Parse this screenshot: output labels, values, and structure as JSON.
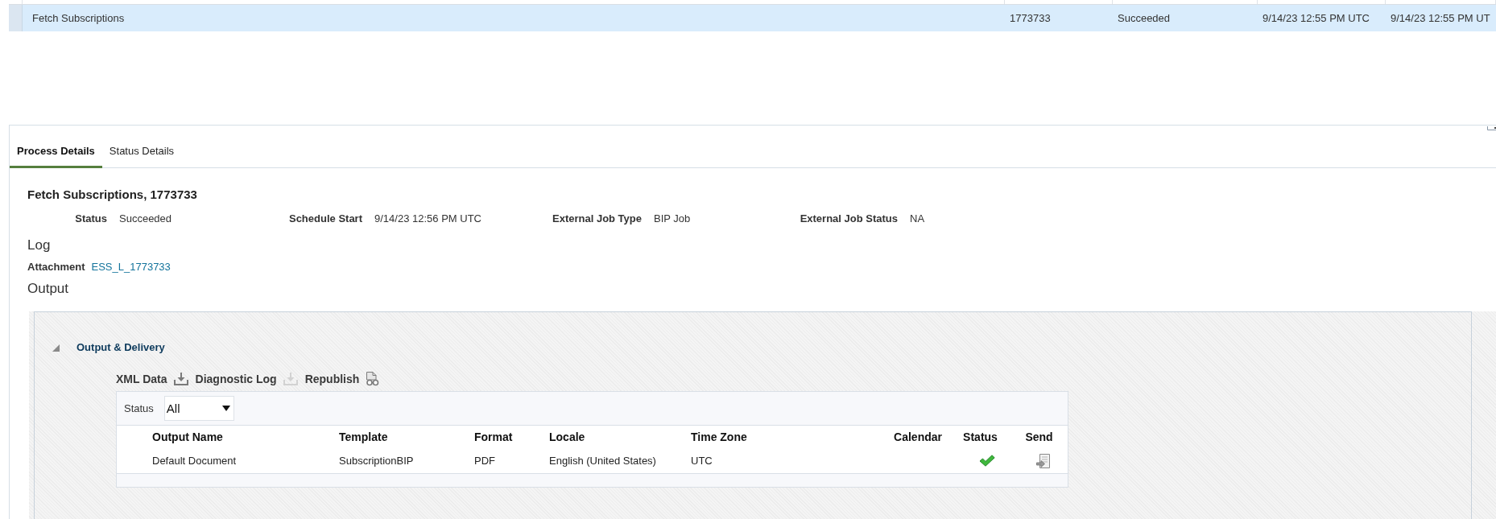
{
  "job_list": {
    "rows": [
      {
        "cells": [
          "Fetch Subscriptions",
          "1773733",
          "Succeeded",
          "9/14/23 12:55 PM UTC",
          "9/14/23 12:55 PM UT"
        ],
        "selected": true
      }
    ]
  },
  "tabs": [
    {
      "label": "Process Details",
      "selected": true
    },
    {
      "label": "Status Details",
      "selected": false
    }
  ],
  "process": {
    "title": "Fetch Subscriptions, 1773733",
    "fields": [
      {
        "label": "Status",
        "value": "Succeeded"
      },
      {
        "label": "Schedule Start",
        "value": "9/14/23 12:56 PM UTC"
      },
      {
        "label": "External Job Type",
        "value": "BIP Job"
      },
      {
        "label": "External Job Status",
        "value": "NA"
      }
    ]
  },
  "log": {
    "heading": "Log",
    "attachment_label": "Attachment",
    "attachment_link": "ESS_L_1773733"
  },
  "output": {
    "heading": "Output",
    "section": {
      "title": "Output & Delivery",
      "expanded": true,
      "toolbar": [
        {
          "label": "XML Data",
          "kind": "download",
          "disabled": false
        },
        {
          "label": "Diagnostic Log",
          "kind": "download",
          "disabled": true
        },
        {
          "label": "Republish",
          "kind": "republish",
          "disabled": false
        }
      ],
      "filter": {
        "label": "Status",
        "value": "All"
      },
      "table": {
        "columns": [
          "Output Name",
          "Template",
          "Format",
          "Locale",
          "Time Zone",
          "Calendar",
          "Status",
          "Send"
        ],
        "rows": [
          {
            "cells": [
              "Default Document",
              "SubscriptionBIP",
              "PDF",
              "English (United States)",
              "UTC"
            ],
            "succeeded": true
          }
        ]
      }
    }
  }
}
